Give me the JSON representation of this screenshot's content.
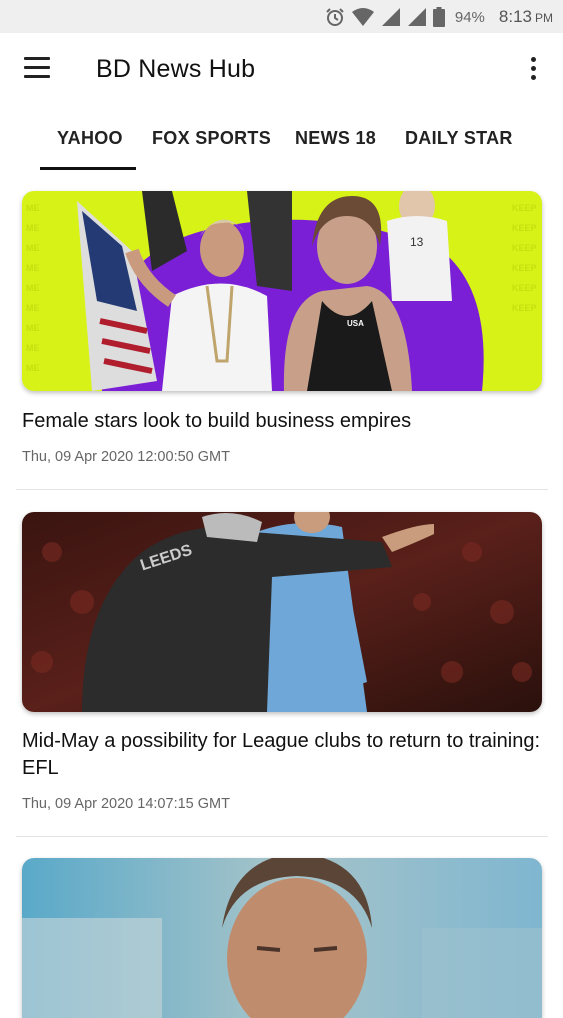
{
  "status_bar": {
    "battery_percent": "94%",
    "time": "8:13",
    "ampm": "PM",
    "icons": [
      "alarm-icon",
      "wifi-icon",
      "signal-icon",
      "signal-icon",
      "battery-icon"
    ]
  },
  "app_bar": {
    "title": "BD News Hub",
    "menu_icon": "hamburger-menu-icon",
    "overflow_icon": "more-vert-icon"
  },
  "tabs": [
    {
      "label": "YAHOO",
      "selected": true
    },
    {
      "label": "FOX SPORTS",
      "selected": false
    },
    {
      "label": "NEWS 18",
      "selected": false
    },
    {
      "label": "DAILY STAR",
      "selected": false
    }
  ],
  "articles": [
    {
      "headline": "Female stars look to build business empires",
      "date": "Thu, 09 Apr 2020 12:00:50 GMT"
    },
    {
      "headline": "Mid-May a possibility for League clubs to return to training: EFL",
      "date": "Thu, 09 Apr 2020 14:07:15 GMT"
    },
    {
      "headline": "",
      "date": ""
    }
  ],
  "image_text": {
    "jersey_number": "13",
    "swimsuit_text": "USA",
    "jacket_text": "LEEDS"
  },
  "colors": {
    "accent": "#111111",
    "neon_green": "#d6f216",
    "purple": "#7a1fd6"
  }
}
